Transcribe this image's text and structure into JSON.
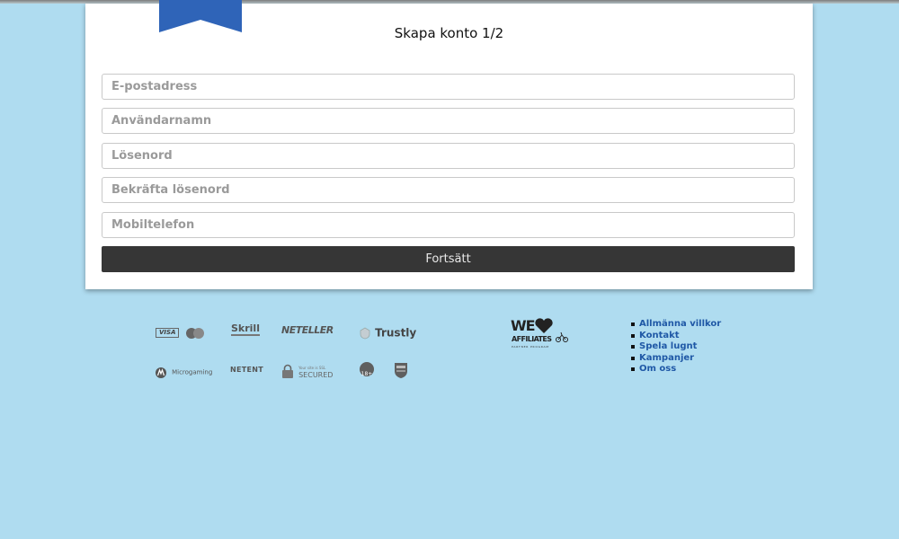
{
  "form": {
    "title": "Skapa konto 1/2",
    "fields": [
      {
        "placeholder": "E-postadress",
        "value": ""
      },
      {
        "placeholder": "Användarnamn",
        "value": ""
      },
      {
        "placeholder": "Lösenord",
        "value": ""
      },
      {
        "placeholder": "Bekräfta lösenord",
        "value": ""
      },
      {
        "placeholder": "Mobiltelefon",
        "value": ""
      }
    ],
    "continue_label": "Fortsätt"
  },
  "footer": {
    "logos": {
      "visa": "VISA",
      "skrill": "Skrill",
      "neteller": "NETELLER",
      "trustly": "Trustly",
      "microgaming": "Microgaming",
      "netent": "NETENT",
      "secured_top": "Your site is SSL",
      "secured": "SECURED",
      "age": "18+",
      "affiliates_we": "WE",
      "affiliates_name": "AFFILIATES",
      "affiliates_sub": "PARTNER PROGRAM"
    },
    "links": [
      "Allmänna villkor",
      "Kontakt",
      "Spela lugnt",
      "Kampanjer",
      "Om oss"
    ]
  },
  "colors": {
    "background": "#afdcf0",
    "ribbon": "#2f64b8",
    "button": "#363636",
    "link": "#1f58a6"
  }
}
